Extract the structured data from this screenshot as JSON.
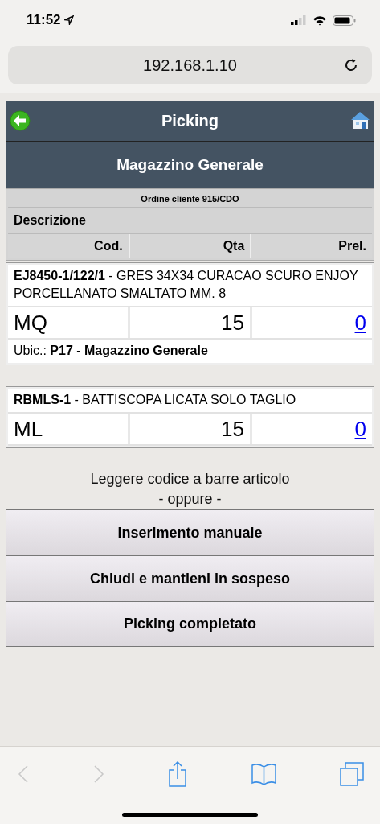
{
  "status_bar": {
    "time": "11:52"
  },
  "address_bar": {
    "url": "192.168.1.10"
  },
  "header": {
    "title": "Picking",
    "subtitle": "Magazzino Generale"
  },
  "order": {
    "title": "Ordine cliente 915/CDO",
    "description_heading": "Descrizione",
    "columns": [
      "Cod.",
      "Qta",
      "Prel."
    ]
  },
  "items": [
    {
      "description": "**EJ8450-1/122/1** - GRES 34X34 CURACAO SCURO ENJOY PORCELLANATO SMALTATO MM. 8",
      "unit": "MQ",
      "quantity": "15",
      "picked": "0",
      "location": "Ubic.: **P17 - Magazzino Generale**"
    },
    {
      "description": "**RBMLS-1** - BATTISCOPA LICATA SOLO TAGLIO",
      "unit": "ML",
      "quantity": "15",
      "picked": "0"
    }
  ],
  "instructions": [
    "Leggere codice a barre articolo",
    "- oppure -"
  ],
  "buttons": [
    "Inserimento manuale",
    "Chiudi e mantieni in sospeso",
    "Picking completato"
  ],
  "browser_toolbar": {
    "back": {
      "disabled": true
    },
    "forward": {
      "disabled": true
    }
  }
}
